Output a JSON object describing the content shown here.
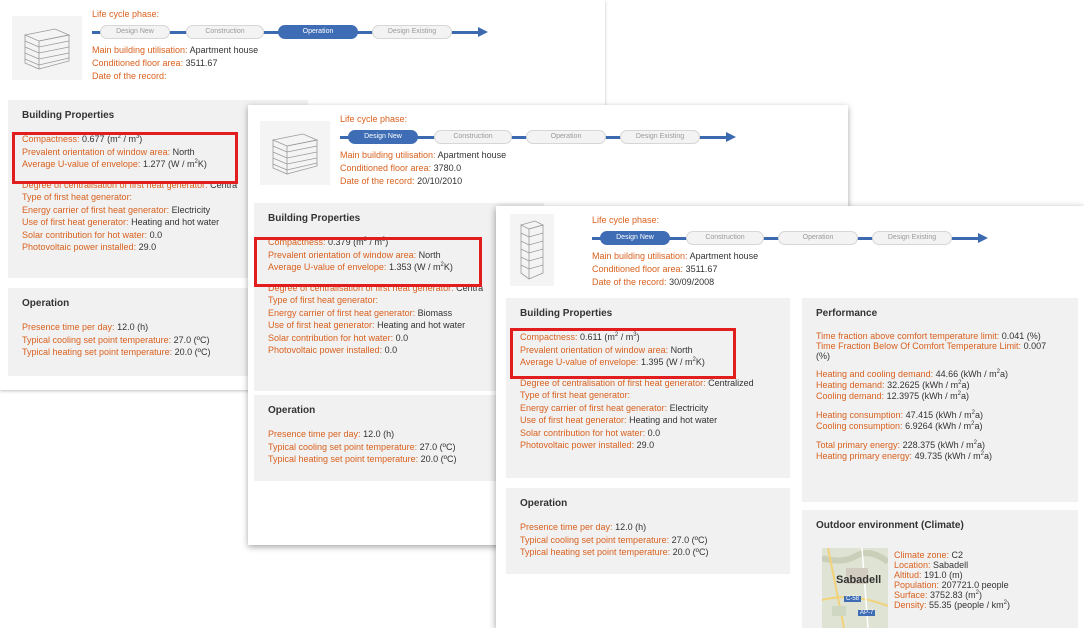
{
  "phases": {
    "title": "Life cycle phase:",
    "labels": [
      "Design New",
      "Construction",
      "Operation",
      "Design Existing"
    ]
  },
  "labels": {
    "utilisation": "Main building utilisation:",
    "floor_area": "Conditioned floor area:",
    "record_date": "Date of the record:",
    "building_properties": "Building Properties",
    "compactness": "Compactness:",
    "orientation": "Prevalent orientation of window area:",
    "uvalue": "Average U-value of envelope:",
    "centralisation": "Degree of centralisation of first heat generator:",
    "generator_type": "Type of first heat generator:",
    "energy_carrier": "Energy carrier of first heat generator:",
    "generator_use": "Use of first heat generator:",
    "solar": "Solar contribution for hot water:",
    "pv": "Photovoltaic power installed:",
    "operation": "Operation",
    "presence": "Presence time per day:",
    "cooling_sp": "Typical cooling set point temperature:",
    "heating_sp": "Typical heating set point temperature:",
    "performance": "Performance",
    "time_above": "Time fraction above comfort temperature limit:",
    "time_below": "Time Fraction Below Of Comfort Temperature Limit:",
    "hc_demand": "Heating and cooling demand:",
    "h_demand": "Heating demand:",
    "c_demand": "Cooling demand:",
    "h_consumption": "Heating consumption:",
    "c_consumption": "Cooling consumption:",
    "total_primary": "Total primary energy:",
    "heating_primary": "Heating primary energy:",
    "outdoor": "Outdoor environment (Climate)",
    "climate_zone": "Climate zone:",
    "location": "Location:",
    "altitude": "Altitud:",
    "population": "Population:",
    "surface": "Surface:",
    "density": "Density:"
  },
  "units": {
    "compactness": "(m2 / m3)",
    "uvalue": "(W / m2K)",
    "hours": "(h)",
    "celsius": "(ºC)",
    "percent": "(%)",
    "energy": "(kWh / m2a)",
    "altitude": "(m)",
    "people": "people",
    "surface": "(m2)",
    "density": "(people / km2)"
  },
  "cards": [
    {
      "active_phase": "Operation",
      "utilisation": "Apartment house",
      "floor_area": "3511.67",
      "record_date": "",
      "compactness": "0.677",
      "orientation": "North",
      "uvalue": "1.277",
      "centralisation": "Centra",
      "generator_type": "",
      "energy_carrier": "Electricity",
      "generator_use": "Heating and hot water",
      "solar": "0.0",
      "pv": "29.0",
      "presence": "12.0",
      "cooling_sp": "27.0",
      "heating_sp": "20.0"
    },
    {
      "active_phase": "Design New",
      "utilisation": "Apartment house",
      "floor_area": "3780.0",
      "record_date": "20/10/2010",
      "compactness": "0.379",
      "orientation": "North",
      "uvalue": "1.353",
      "centralisation": "Centra",
      "generator_type": "",
      "energy_carrier": "Biomass",
      "generator_use": "Heating and hot water",
      "solar": "0.0",
      "pv": "0.0",
      "presence": "12.0",
      "cooling_sp": "27.0",
      "heating_sp": "20.0"
    },
    {
      "active_phase": "Design New",
      "utilisation": "Apartment house",
      "floor_area": "3511.67",
      "record_date": "30/09/2008",
      "compactness": "0.611",
      "orientation": "North",
      "uvalue": "1.395",
      "centralisation": "Centralized",
      "generator_type": "",
      "energy_carrier": "Electricity",
      "generator_use": "Heating and hot water",
      "solar": "0.0",
      "pv": "29.0",
      "presence": "12.0",
      "cooling_sp": "27.0",
      "heating_sp": "20.0",
      "performance": {
        "time_above": "0.041",
        "time_below": "0.007",
        "hc_demand": "44.66",
        "h_demand": "32.2625",
        "c_demand": "12.3975",
        "h_consumption": "47.415",
        "c_consumption": "6.9264",
        "total_primary": "228.375",
        "heating_primary": "49.735"
      },
      "climate": {
        "zone": "C2",
        "location": "Sabadell",
        "altitude": "191.0",
        "population": "207721.0",
        "surface": "3752.83",
        "density": "55.35",
        "map_city": "Sabadell",
        "map_road_1": "C-58",
        "map_road_2": "AP-7"
      }
    }
  ],
  "colors": {
    "label": "#d9611f",
    "active_phase": "#3e6db5",
    "highlight_box": "#e21d1d",
    "panel_bg": "#f1f1f1"
  }
}
